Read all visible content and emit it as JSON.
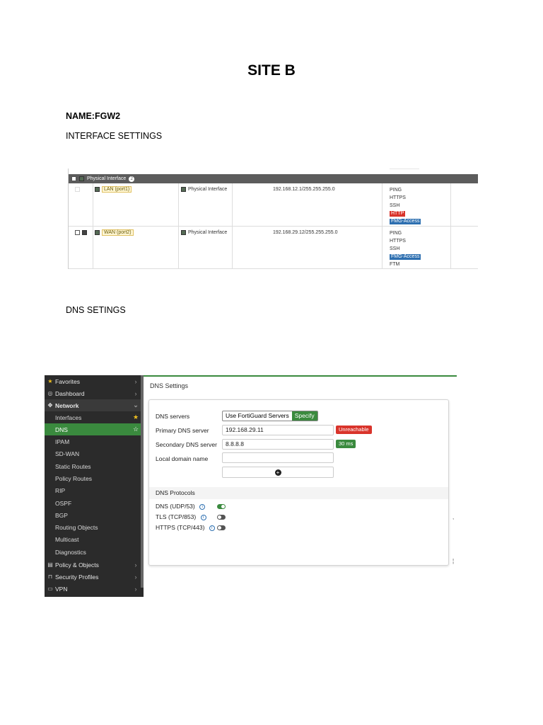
{
  "document": {
    "title": "SITE B",
    "name_line": "NAME:FGW2",
    "interface_heading": "INTERFACE SETTINGS",
    "dns_heading": "DNS SETINGS"
  },
  "interface_table": {
    "group_label": "Physical Interface",
    "group_count": "2",
    "rows": [
      {
        "port": "LAN (port1)",
        "type": "Physical Interface",
        "ip": "192.168.12.1/255.255.255.0",
        "services": [
          {
            "label": "PING",
            "style": "plain"
          },
          {
            "label": "HTTPS",
            "style": "plain"
          },
          {
            "label": "SSH",
            "style": "plain"
          },
          {
            "label": "HTTP",
            "style": "red"
          },
          {
            "label": "FMG-Access",
            "style": "blue"
          }
        ]
      },
      {
        "port": "WAN (port2)",
        "type": "Physical Interface",
        "ip": "192.168.29.12/255.255.255.0",
        "services": [
          {
            "label": "PING",
            "style": "plain"
          },
          {
            "label": "HTTPS",
            "style": "plain"
          },
          {
            "label": "SSH",
            "style": "plain"
          },
          {
            "label": "FMG-Access",
            "style": "blue"
          },
          {
            "label": "FTM",
            "style": "plain"
          }
        ]
      }
    ]
  },
  "sidebar": {
    "items": [
      {
        "label": "Favorites",
        "icon": "star-icon",
        "chevron": "›",
        "kind": "section-plain"
      },
      {
        "label": "Dashboard",
        "icon": "dashboard-icon",
        "chevron": "›",
        "kind": "section-plain"
      },
      {
        "label": "Network",
        "icon": "network-icon",
        "chevron": "⌄",
        "kind": "section"
      },
      {
        "label": "Interfaces",
        "icon": "",
        "chevron": "★",
        "kind": "sub"
      },
      {
        "label": "DNS",
        "icon": "",
        "chevron": "☆",
        "kind": "active"
      },
      {
        "label": "IPAM",
        "icon": "",
        "chevron": "",
        "kind": "sub"
      },
      {
        "label": "SD-WAN",
        "icon": "",
        "chevron": "",
        "kind": "sub"
      },
      {
        "label": "Static Routes",
        "icon": "",
        "chevron": "",
        "kind": "sub"
      },
      {
        "label": "Policy Routes",
        "icon": "",
        "chevron": "",
        "kind": "sub"
      },
      {
        "label": "RIP",
        "icon": "",
        "chevron": "",
        "kind": "sub"
      },
      {
        "label": "OSPF",
        "icon": "",
        "chevron": "",
        "kind": "sub"
      },
      {
        "label": "BGP",
        "icon": "",
        "chevron": "",
        "kind": "sub"
      },
      {
        "label": "Routing Objects",
        "icon": "",
        "chevron": "",
        "kind": "sub"
      },
      {
        "label": "Multicast",
        "icon": "",
        "chevron": "",
        "kind": "sub"
      },
      {
        "label": "Diagnostics",
        "icon": "",
        "chevron": "",
        "kind": "sub"
      },
      {
        "label": "Policy & Objects",
        "icon": "policy-icon",
        "chevron": "›",
        "kind": "section-plain"
      },
      {
        "label": "Security Profiles",
        "icon": "lock-icon",
        "chevron": "›",
        "kind": "section-plain"
      },
      {
        "label": "VPN",
        "icon": "monitor-icon",
        "chevron": "›",
        "kind": "section-plain"
      }
    ]
  },
  "dns_settings": {
    "page_title": "DNS Settings",
    "dns_servers_label": "DNS servers",
    "server_options": [
      "Use FortiGuard Servers",
      "Specify"
    ],
    "selected_option": "Specify",
    "primary_label": "Primary DNS server",
    "primary_value": "192.168.29.11",
    "primary_status": "Unreachable",
    "secondary_label": "Secondary DNS server",
    "secondary_value": "8.8.8.8",
    "secondary_status": "30 ms",
    "local_domain_label": "Local domain name",
    "local_domain_value": "",
    "add_symbol": "+",
    "protocols_header": "DNS Protocols",
    "protocols": [
      {
        "label": "DNS (UDP/53)",
        "enabled": true
      },
      {
        "label": "TLS (TCP/853)",
        "enabled": false
      },
      {
        "label": "HTTPS (TCP/443)",
        "enabled": false
      }
    ]
  },
  "colors": {
    "accent_green": "#3a8a3e",
    "error_red": "#d9342b",
    "info_blue": "#2d6fb0",
    "sidebar_bg": "#2b2b2b"
  }
}
